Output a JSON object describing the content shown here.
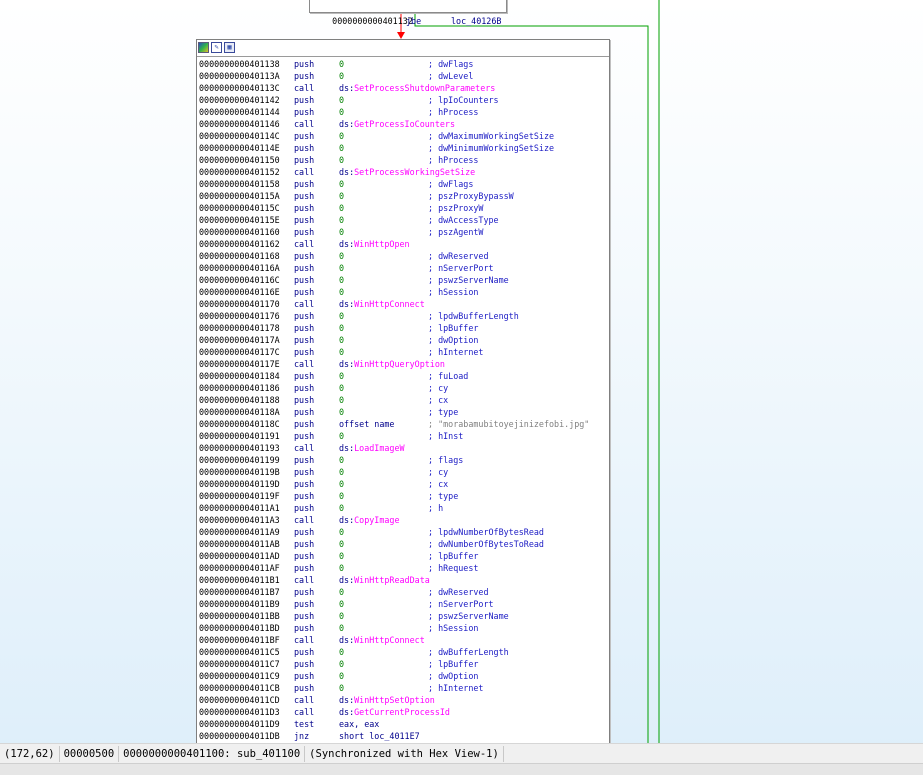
{
  "top_block": {
    "address": "0000000000401132",
    "mnemonic": "jbe",
    "operand": "loc_40126B"
  },
  "toolbar": {
    "icons": [
      "graph-overview-icon",
      "rename-icon",
      "group-nodes-icon"
    ]
  },
  "instructions": [
    {
      "addr": "0000000000401138",
      "mn": "push",
      "op": "0",
      "cmt": "; dwFlags"
    },
    {
      "addr": "000000000040113A",
      "mn": "push",
      "op": "0",
      "cmt": "; dwLevel"
    },
    {
      "addr": "000000000040113C",
      "mn": "call",
      "op_prefix": "ds:",
      "op_fn": "SetProcessShutdownParameters"
    },
    {
      "addr": "0000000000401142",
      "mn": "push",
      "op": "0",
      "cmt": "; lpIoCounters"
    },
    {
      "addr": "0000000000401144",
      "mn": "push",
      "op": "0",
      "cmt": "; hProcess"
    },
    {
      "addr": "0000000000401146",
      "mn": "call",
      "op_prefix": "ds:",
      "op_fn": "GetProcessIoCounters"
    },
    {
      "addr": "000000000040114C",
      "mn": "push",
      "op": "0",
      "cmt": "; dwMaximumWorkingSetSize"
    },
    {
      "addr": "000000000040114E",
      "mn": "push",
      "op": "0",
      "cmt": "; dwMinimumWorkingSetSize"
    },
    {
      "addr": "0000000000401150",
      "mn": "push",
      "op": "0",
      "cmt": "; hProcess"
    },
    {
      "addr": "0000000000401152",
      "mn": "call",
      "op_prefix": "ds:",
      "op_fn": "SetProcessWorkingSetSize"
    },
    {
      "addr": "0000000000401158",
      "mn": "push",
      "op": "0",
      "cmt": "; dwFlags"
    },
    {
      "addr": "000000000040115A",
      "mn": "push",
      "op": "0",
      "cmt": "; pszProxyBypassW"
    },
    {
      "addr": "000000000040115C",
      "mn": "push",
      "op": "0",
      "cmt": "; pszProxyW"
    },
    {
      "addr": "000000000040115E",
      "mn": "push",
      "op": "0",
      "cmt": "; dwAccessType"
    },
    {
      "addr": "0000000000401160",
      "mn": "push",
      "op": "0",
      "cmt": "; pszAgentW"
    },
    {
      "addr": "0000000000401162",
      "mn": "call",
      "op_prefix": "ds:",
      "op_fn": "WinHttpOpen"
    },
    {
      "addr": "0000000000401168",
      "mn": "push",
      "op": "0",
      "cmt": "; dwReserved"
    },
    {
      "addr": "000000000040116A",
      "mn": "push",
      "op": "0",
      "cmt": "; nServerPort"
    },
    {
      "addr": "000000000040116C",
      "mn": "push",
      "op": "0",
      "cmt": "; pswzServerName"
    },
    {
      "addr": "000000000040116E",
      "mn": "push",
      "op": "0",
      "cmt": "; hSession"
    },
    {
      "addr": "0000000000401170",
      "mn": "call",
      "op_prefix": "ds:",
      "op_fn": "WinHttpConnect"
    },
    {
      "addr": "0000000000401176",
      "mn": "push",
      "op": "0",
      "cmt": "; lpdwBufferLength"
    },
    {
      "addr": "0000000000401178",
      "mn": "push",
      "op": "0",
      "cmt": "; lpBuffer"
    },
    {
      "addr": "000000000040117A",
      "mn": "push",
      "op": "0",
      "cmt": "; dwOption"
    },
    {
      "addr": "000000000040117C",
      "mn": "push",
      "op": "0",
      "cmt": "; hInternet"
    },
    {
      "addr": "000000000040117E",
      "mn": "call",
      "op_prefix": "ds:",
      "op_fn": "WinHttpQueryOption"
    },
    {
      "addr": "0000000000401184",
      "mn": "push",
      "op": "0",
      "cmt": "; fuLoad"
    },
    {
      "addr": "0000000000401186",
      "mn": "push",
      "op": "0",
      "cmt": "; cy"
    },
    {
      "addr": "0000000000401188",
      "mn": "push",
      "op": "0",
      "cmt": "; cx"
    },
    {
      "addr": "000000000040118A",
      "mn": "push",
      "op": "0",
      "cmt": "; type"
    },
    {
      "addr": "000000000040118C",
      "mn": "push",
      "op": "offset name",
      "op_text": true,
      "cmt": "; \"morabamubitoyejinizefobi.jpg\"",
      "cmt_str": true
    },
    {
      "addr": "0000000000401191",
      "mn": "push",
      "op": "0",
      "cmt": "; hInst"
    },
    {
      "addr": "0000000000401193",
      "mn": "call",
      "op_prefix": "ds:",
      "op_fn": "LoadImageW"
    },
    {
      "addr": "0000000000401199",
      "mn": "push",
      "op": "0",
      "cmt": "; flags"
    },
    {
      "addr": "000000000040119B",
      "mn": "push",
      "op": "0",
      "cmt": "; cy"
    },
    {
      "addr": "000000000040119D",
      "mn": "push",
      "op": "0",
      "cmt": "; cx"
    },
    {
      "addr": "000000000040119F",
      "mn": "push",
      "op": "0",
      "cmt": "; type"
    },
    {
      "addr": "00000000004011A1",
      "mn": "push",
      "op": "0",
      "cmt": "; h"
    },
    {
      "addr": "00000000004011A3",
      "mn": "call",
      "op_prefix": "ds:",
      "op_fn": "CopyImage"
    },
    {
      "addr": "00000000004011A9",
      "mn": "push",
      "op": "0",
      "cmt": "; lpdwNumberOfBytesRead"
    },
    {
      "addr": "00000000004011AB",
      "mn": "push",
      "op": "0",
      "cmt": "; dwNumberOfBytesToRead"
    },
    {
      "addr": "00000000004011AD",
      "mn": "push",
      "op": "0",
      "cmt": "; lpBuffer"
    },
    {
      "addr": "00000000004011AF",
      "mn": "push",
      "op": "0",
      "cmt": "; hRequest"
    },
    {
      "addr": "00000000004011B1",
      "mn": "call",
      "op_prefix": "ds:",
      "op_fn": "WinHttpReadData"
    },
    {
      "addr": "00000000004011B7",
      "mn": "push",
      "op": "0",
      "cmt": "; dwReserved"
    },
    {
      "addr": "00000000004011B9",
      "mn": "push",
      "op": "0",
      "cmt": "; nServerPort"
    },
    {
      "addr": "00000000004011BB",
      "mn": "push",
      "op": "0",
      "cmt": "; pswzServerName"
    },
    {
      "addr": "00000000004011BD",
      "mn": "push",
      "op": "0",
      "cmt": "; hSession"
    },
    {
      "addr": "00000000004011BF",
      "mn": "call",
      "op_prefix": "ds:",
      "op_fn": "WinHttpConnect"
    },
    {
      "addr": "00000000004011C5",
      "mn": "push",
      "op": "0",
      "cmt": "; dwBufferLength"
    },
    {
      "addr": "00000000004011C7",
      "mn": "push",
      "op": "0",
      "cmt": "; lpBuffer"
    },
    {
      "addr": "00000000004011C9",
      "mn": "push",
      "op": "0",
      "cmt": "; dwOption"
    },
    {
      "addr": "00000000004011CB",
      "mn": "push",
      "op": "0",
      "cmt": "; hInternet"
    },
    {
      "addr": "00000000004011CD",
      "mn": "call",
      "op_prefix": "ds:",
      "op_fn": "WinHttpSetOption"
    },
    {
      "addr": "00000000004011D3",
      "mn": "call",
      "op_prefix": "ds:",
      "op_fn": "GetCurrentProcessId"
    },
    {
      "addr": "00000000004011D9",
      "mn": "test",
      "op": "eax, eax",
      "op_text": true
    },
    {
      "addr": "00000000004011DB",
      "mn": "jnz",
      "op": "short loc_4011E7",
      "op_text": true
    }
  ],
  "statusbar": {
    "coords": "(172,62)",
    "offset": "00000500",
    "location": "0000000000401100: sub_401100",
    "sync": "(Synchronized with Hex View-1)"
  },
  "colors": {
    "address": "#000000",
    "mnemonic": "#00008b",
    "operand_number": "#008000",
    "imported_function": "#ff00ff",
    "comment": "#1c1cc4",
    "string_comment": "#808080",
    "edge_false": "#ff0000",
    "edge_true": "#00a000"
  }
}
